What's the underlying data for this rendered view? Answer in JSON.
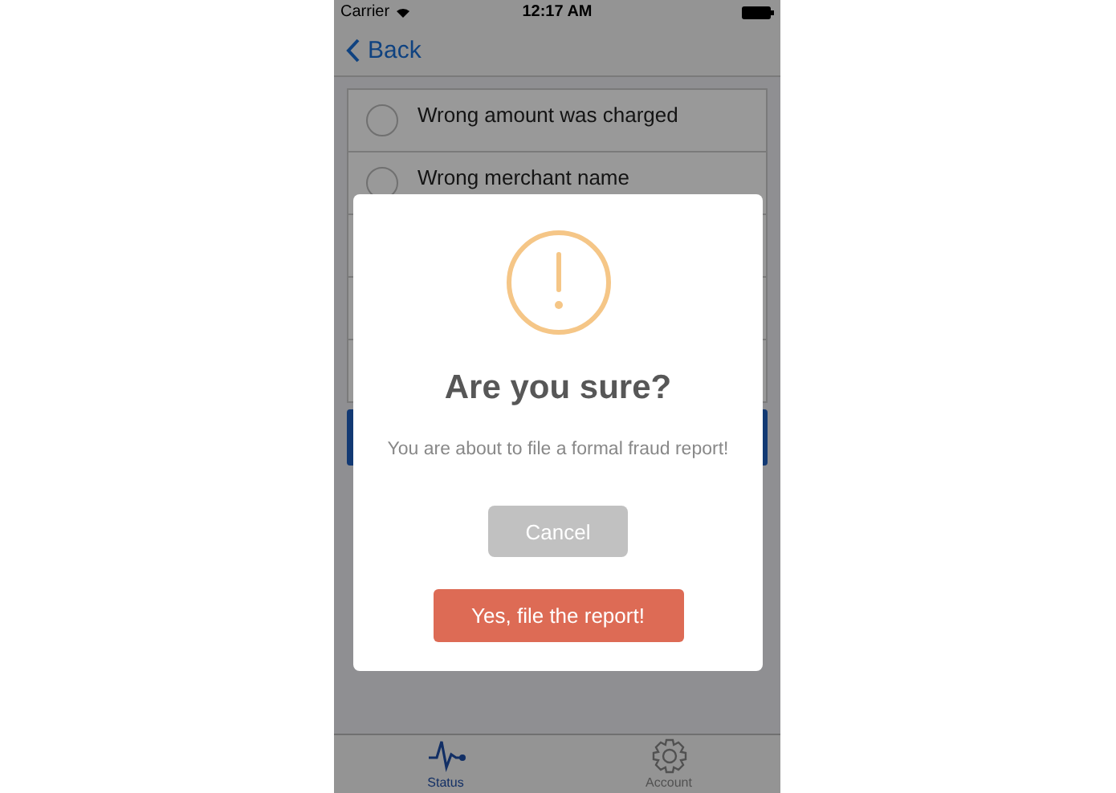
{
  "status_bar": {
    "carrier": "Carrier",
    "time": "12:17 AM"
  },
  "nav": {
    "back": "Back"
  },
  "options": [
    {
      "label": "Wrong amount was charged",
      "selected": false
    },
    {
      "label": "Wrong merchant name",
      "selected": false
    }
  ],
  "dialog": {
    "title": "Are you sure?",
    "message": "You are about to file a formal fraud report!",
    "cancel": "Cancel",
    "confirm": "Yes, file the report!"
  },
  "tabs": [
    {
      "label": "Status",
      "kind": "pulse",
      "selected": true
    },
    {
      "label": "Account",
      "kind": "gear",
      "selected": false
    }
  ]
}
